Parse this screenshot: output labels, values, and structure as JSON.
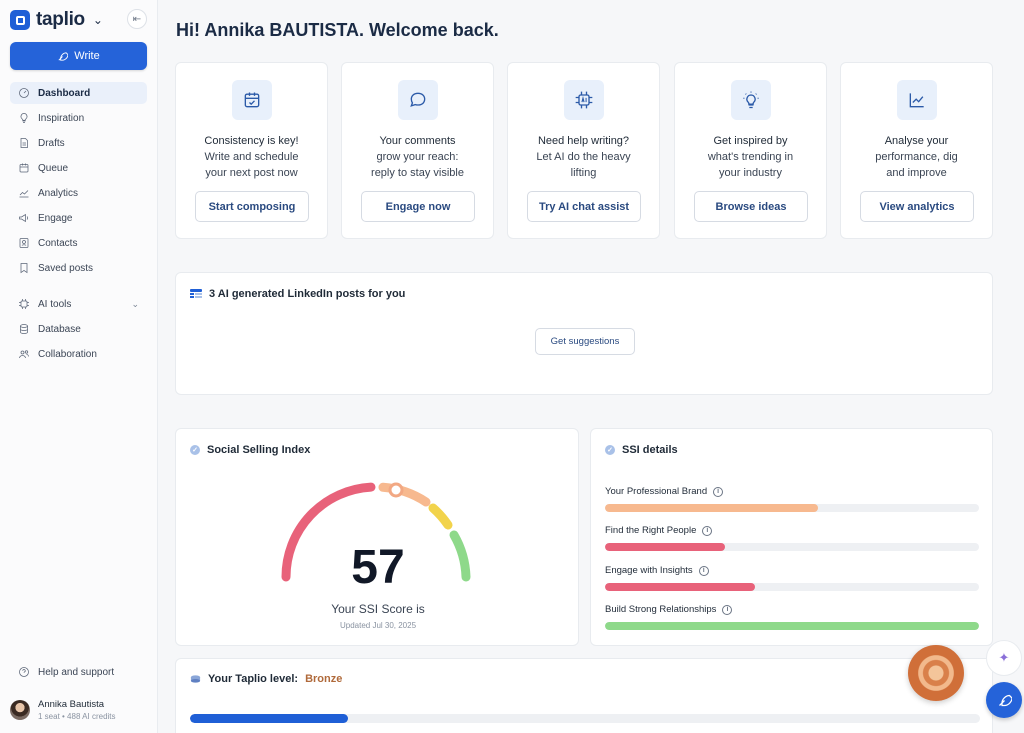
{
  "app": {
    "name": "taplio"
  },
  "sidebar": {
    "write_label": "Write",
    "items": [
      {
        "label": "Dashboard",
        "icon": "dashboard-icon"
      },
      {
        "label": "Inspiration",
        "icon": "bulb-icon"
      },
      {
        "label": "Drafts",
        "icon": "drafts-icon"
      },
      {
        "label": "Queue",
        "icon": "calendar-icon"
      },
      {
        "label": "Analytics",
        "icon": "analytics-icon"
      },
      {
        "label": "Engage",
        "icon": "megaphone-icon"
      },
      {
        "label": "Contacts",
        "icon": "contacts-icon"
      },
      {
        "label": "Saved posts",
        "icon": "bookmark-icon"
      }
    ],
    "tools": [
      {
        "label": "AI tools",
        "icon": "ai-chip-icon"
      },
      {
        "label": "Database",
        "icon": "database-icon"
      },
      {
        "label": "Collaboration",
        "icon": "users-icon"
      }
    ],
    "help_label": "Help and support",
    "user": {
      "name": "Annika Bautista",
      "meta": "1 seat • 488 AI credits"
    }
  },
  "greeting": "Hi! Annika BAUTISTA. Welcome back.",
  "quick_actions": [
    {
      "line1": "Consistency is key!",
      "line2": "Write and schedule",
      "line3": "your next post now",
      "button": "Start composing",
      "icon": "calendar-check-icon"
    },
    {
      "line1": "Your comments",
      "line2": "grow your reach:",
      "line3": "reply to stay visible",
      "button": "Engage now",
      "icon": "comment-icon"
    },
    {
      "line1": "Need help writing?",
      "line2": "Let AI do the heavy",
      "line3": "lifting",
      "button": "Try AI chat assist",
      "icon": "ai-chip-icon"
    },
    {
      "line1": "Get inspired by",
      "line2": "what's trending in",
      "line3": "your industry",
      "button": "Browse ideas",
      "icon": "bulb-icon"
    },
    {
      "line1": "Analyse your",
      "line2": "performance, dig",
      "line3": "and improve",
      "button": "View analytics",
      "icon": "analytics-icon"
    }
  ],
  "ai_posts": {
    "title": "3 AI generated LinkedIn posts for you",
    "button": "Get suggestions"
  },
  "ssi": {
    "title": "Social Selling Index",
    "score": "57",
    "score_value": 57,
    "label": "Your SSI Score is",
    "updated": "Updated Jul 30, 2025"
  },
  "ssi_details": {
    "title": "SSI details",
    "rows": [
      {
        "label": "Your Professional Brand",
        "fraction": 0.57,
        "color": "#f7b98f"
      },
      {
        "label": "Find the Right People",
        "fraction": 0.32,
        "color": "#e8627a"
      },
      {
        "label": "Engage with Insights",
        "fraction": 0.4,
        "color": "#e8627a"
      },
      {
        "label": "Build Strong Relationships",
        "fraction": 1.0,
        "color": "#8ed98a"
      }
    ]
  },
  "level": {
    "prefix": "Your Taplio level:",
    "name": "Bronze",
    "progress": 0.2
  },
  "colors": {
    "accent": "#2563d9",
    "bronze": "#b06a3b"
  }
}
